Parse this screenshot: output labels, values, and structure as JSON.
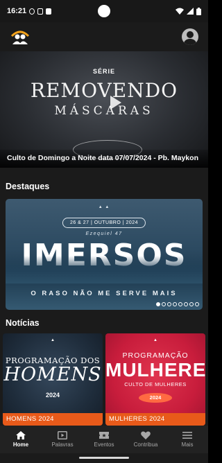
{
  "status_bar": {
    "time": "16:21",
    "notification_icons": [
      "silent-notification-icon",
      "sim-icon",
      "file-icon"
    ],
    "system_icons": [
      "wifi-icon",
      "signal-icon",
      "battery-icon"
    ]
  },
  "header": {
    "logo_icon": "church-logo-icon",
    "account_icon": "account-circle-icon"
  },
  "hero": {
    "serie_label": "SÉRIE",
    "title_line1": "REMOVENDO",
    "title_line2": "MÁSCARAS",
    "caption": "Culto de Domingo a Noite data 07/07/2024 - Pb. Maykon"
  },
  "highlights": {
    "section_title": "Destaques",
    "banner": {
      "dates": "26 & 27 | OUTUBRO | 2024",
      "verse": "Ezequiel 47",
      "title": "IMERSOS",
      "tagline": "O RASO NÃO ME SERVE MAIS"
    },
    "carousel_total": 8,
    "carousel_active": 0
  },
  "news": {
    "section_title": "Notícias",
    "items": [
      {
        "top": "PROGRAMAÇÃO DOS",
        "big": "HOMENS",
        "year": "2024",
        "caption": "HOMENS 2024"
      },
      {
        "top": "PROGRAMAÇÃO",
        "big": "MULHERES",
        "sub": "CULTO DE MULHERES",
        "year": "2024",
        "caption": "MULHERES 2024"
      }
    ]
  },
  "bottom_nav": {
    "items": [
      {
        "label": "Home",
        "icon": "home-icon",
        "active": true
      },
      {
        "label": "Palavras",
        "icon": "video-icon",
        "active": false
      },
      {
        "label": "Eventos",
        "icon": "ticket-icon",
        "active": false
      },
      {
        "label": "Contribua",
        "icon": "heart-icon",
        "active": false
      },
      {
        "label": "Mais",
        "icon": "menu-icon",
        "active": false
      }
    ]
  },
  "colors": {
    "background": "#1b1b1b",
    "caption_orange": "#e85a1a",
    "nav_background": "#222222"
  }
}
